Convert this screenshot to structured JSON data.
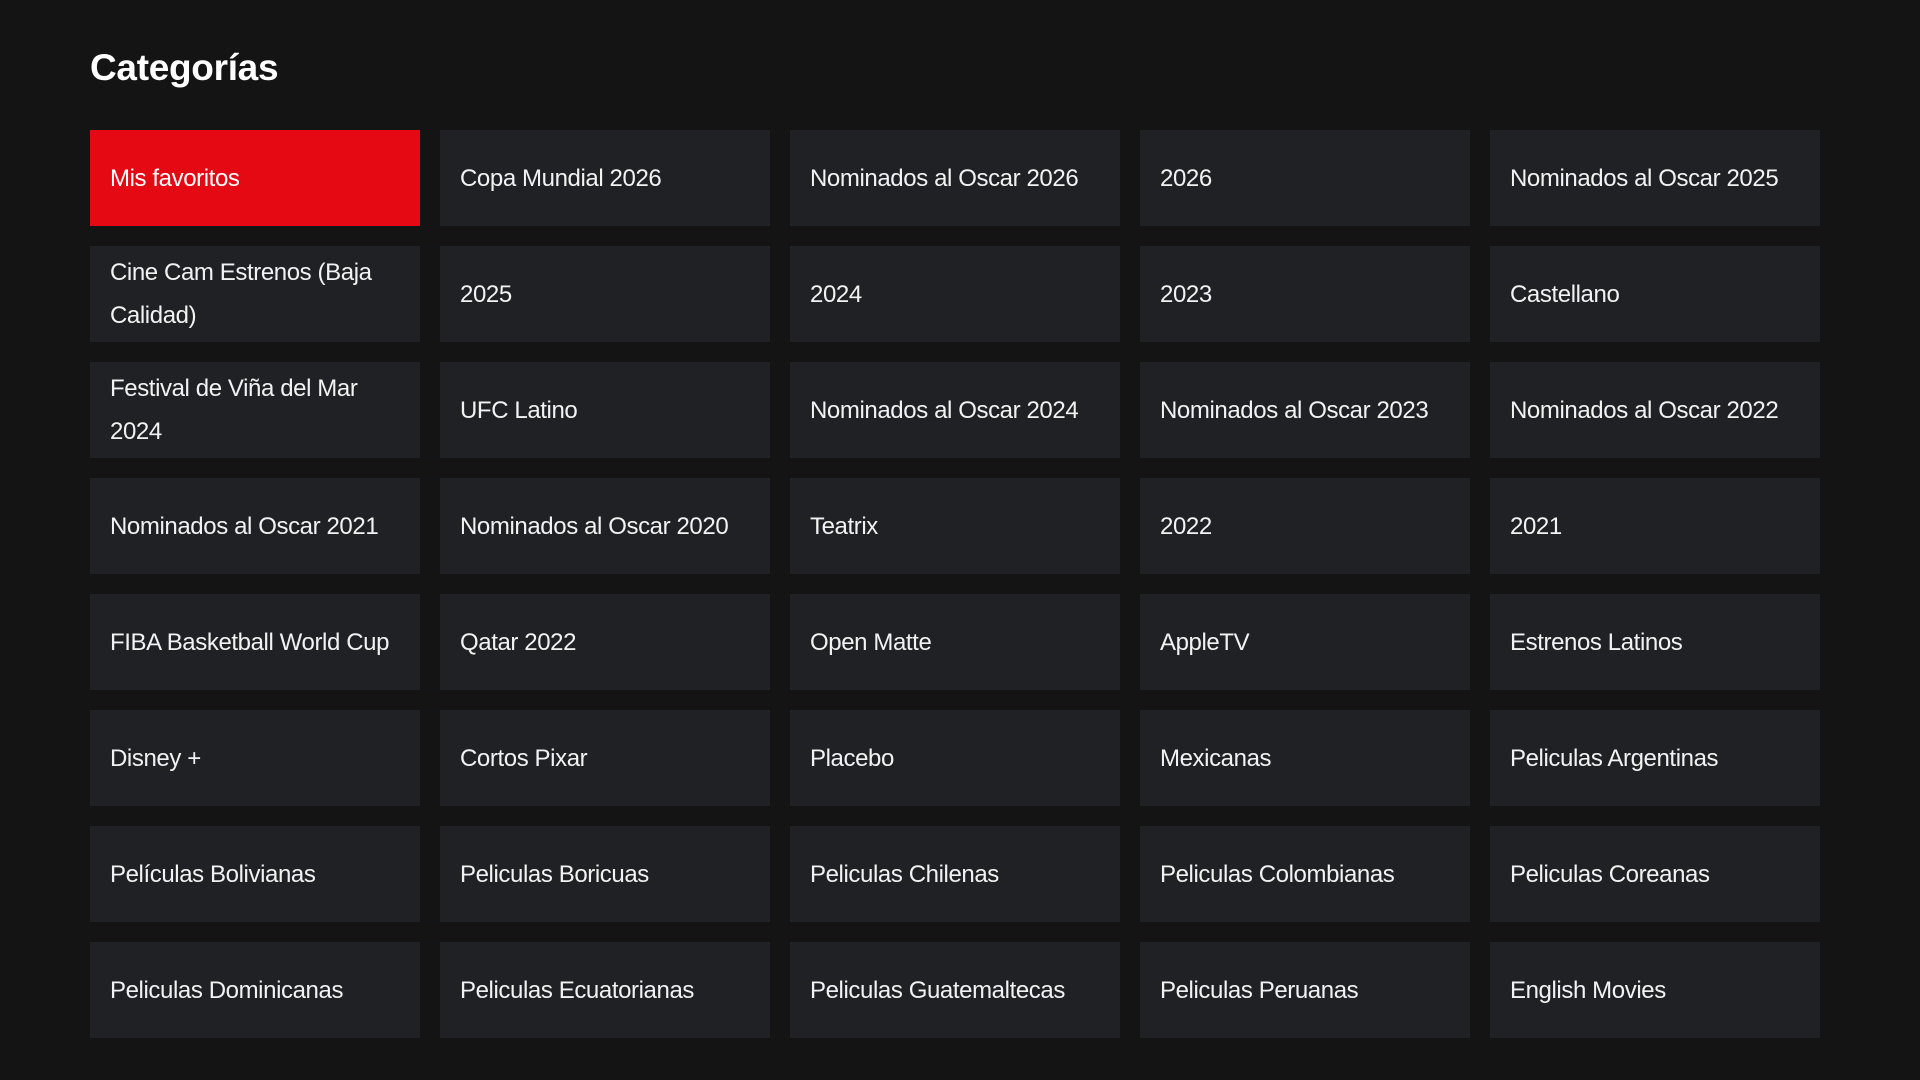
{
  "header": {
    "title": "Categorías"
  },
  "colors": {
    "background": "#141415",
    "tile": "#202125",
    "accent": "#e50914"
  },
  "active_index": 0,
  "categories": [
    "Mis favoritos",
    "Copa Mundial 2026",
    "Nominados al Oscar 2026",
    "2026",
    "Nominados al Oscar 2025",
    "Cine Cam Estrenos (Baja Calidad)",
    "2025",
    "2024",
    "2023",
    "Castellano",
    "Festival de Viña del Mar 2024",
    "UFC Latino",
    "Nominados al Oscar 2024",
    "Nominados al Oscar 2023",
    "Nominados al Oscar 2022",
    "Nominados al Oscar 2021",
    "Nominados al Oscar 2020",
    "Teatrix",
    "2022",
    "2021",
    "FIBA Basketball World Cup",
    "Qatar 2022",
    "Open Matte",
    "AppleTV",
    "Estrenos Latinos",
    "Disney +",
    "Cortos Pixar",
    "Placebo",
    "Mexicanas",
    "Peliculas Argentinas",
    "Películas Bolivianas",
    "Peliculas Boricuas",
    "Peliculas Chilenas",
    "Peliculas Colombianas",
    "Peliculas Coreanas",
    "Peliculas Dominicanas",
    "Peliculas Ecuatorianas",
    "Peliculas Guatemaltecas",
    "Peliculas Peruanas",
    "English Movies"
  ]
}
